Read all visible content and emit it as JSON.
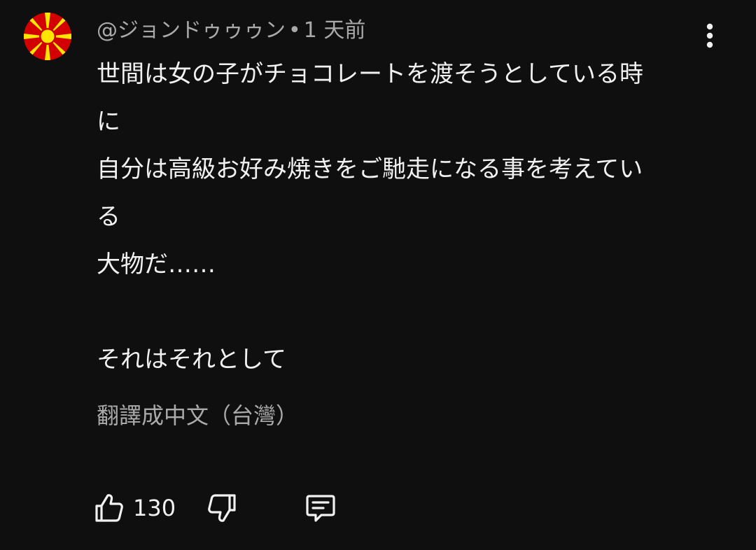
{
  "comment": {
    "author": "@ジョンドゥゥゥン",
    "separator": "•",
    "timestamp": "1 天前",
    "lines": [
      "世間は女の子がチョコレートを渡そうとしている時",
      "に",
      "自分は高級お好み焼きをご馳走になる事を考えてい",
      "る",
      "大物だ……",
      "",
      "それはそれとして"
    ],
    "translate_label": "翻譯成中文（台灣）",
    "like_count": "130"
  },
  "icons": {
    "avatar": "sun-flag-avatar",
    "menu": "more-vertical-icon",
    "like": "thumbs-up-icon",
    "dislike": "thumbs-down-icon",
    "reply": "comment-reply-icon"
  },
  "colors": {
    "background": "#0f0f0f",
    "primary_text": "#f1f1f1",
    "secondary_text": "#aaaaaa",
    "avatar_red": "#d20000",
    "avatar_yellow": "#ffe600"
  }
}
